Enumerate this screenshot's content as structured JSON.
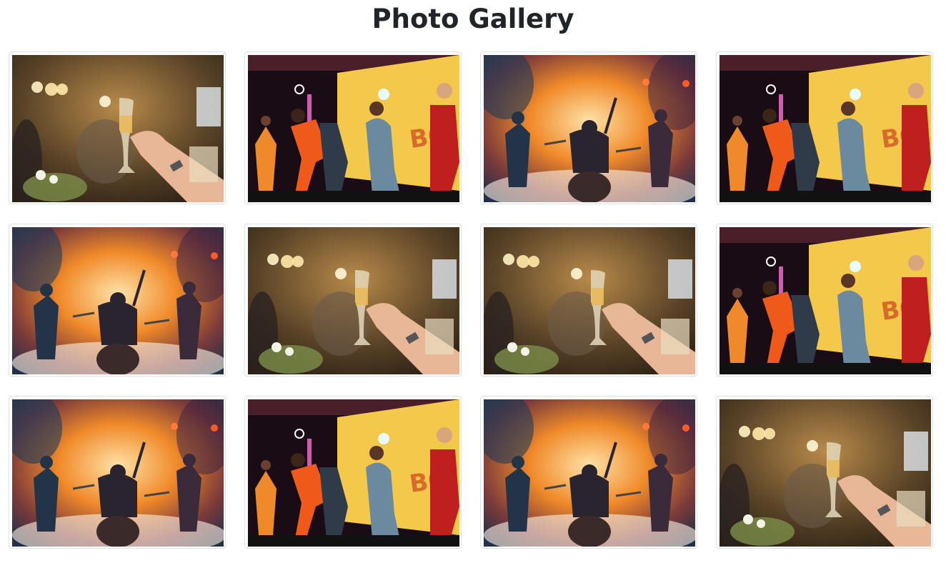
{
  "page": {
    "title": "Photo Gallery"
  },
  "gallery": {
    "items": [
      {
        "scene": "toast",
        "alt": "toast"
      },
      {
        "scene": "stage",
        "alt": "stage"
      },
      {
        "scene": "band",
        "alt": "band"
      },
      {
        "scene": "stage",
        "alt": "stage"
      },
      {
        "scene": "band",
        "alt": "band"
      },
      {
        "scene": "toast",
        "alt": "toast"
      },
      {
        "scene": "toast",
        "alt": "toast"
      },
      {
        "scene": "stage",
        "alt": "stage"
      },
      {
        "scene": "band",
        "alt": "band"
      },
      {
        "scene": "stage",
        "alt": "stage"
      },
      {
        "scene": "band",
        "alt": "band"
      },
      {
        "scene": "toast",
        "alt": "toast"
      }
    ],
    "stage_sign_text": "BO"
  },
  "colors": {
    "toast_bg": "#5a4428",
    "stage_screen": "#f4c84a",
    "band_fire": "#f08a2a"
  }
}
